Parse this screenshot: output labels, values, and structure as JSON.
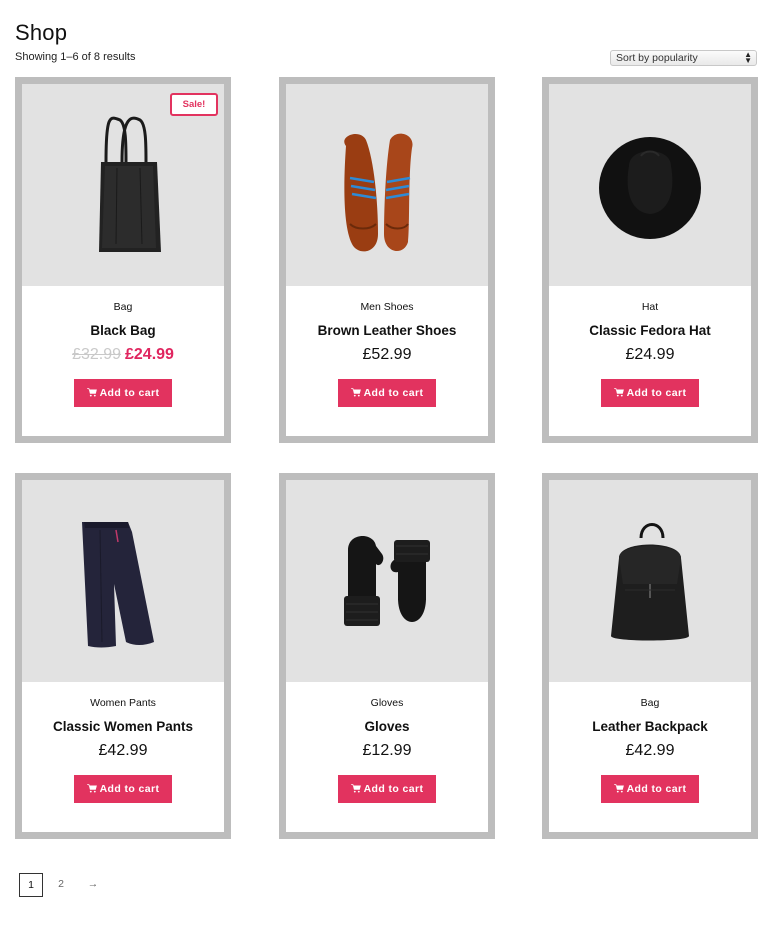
{
  "page": {
    "title": "Shop",
    "result_count": "Showing 1–6 of 8 results",
    "sort_selected": "Sort by popularity"
  },
  "products": [
    {
      "category": "Bag",
      "title": "Black Bag",
      "old_price": "£32.99",
      "price": "£24.99",
      "sale_label": "Sale!",
      "button": "Add to cart",
      "image": "tote-bag-icon"
    },
    {
      "category": "Men Shoes",
      "title": "Brown Leather Shoes",
      "price": "£52.99",
      "button": "Add to cart",
      "image": "shoes-icon"
    },
    {
      "category": "Hat",
      "title": "Classic Fedora Hat",
      "price": "£24.99",
      "button": "Add to cart",
      "image": "fedora-hat-icon"
    },
    {
      "category": "Women Pants",
      "title": "Classic Women Pants",
      "price": "£42.99",
      "button": "Add to cart",
      "image": "pants-icon"
    },
    {
      "category": "Gloves",
      "title": "Gloves",
      "price": "£12.99",
      "button": "Add to cart",
      "image": "mittens-icon"
    },
    {
      "category": "Bag",
      "title": "Leather Backpack",
      "price": "£42.99",
      "button": "Add to cart",
      "image": "backpack-icon"
    }
  ],
  "pagination": {
    "pages": [
      "1",
      "2"
    ],
    "current": "1",
    "next": "→"
  },
  "colors": {
    "accent": "#e2335f",
    "sale_price": "#e0255f",
    "card_border": "#bdbdbd",
    "image_bg": "#e2e2e2"
  }
}
